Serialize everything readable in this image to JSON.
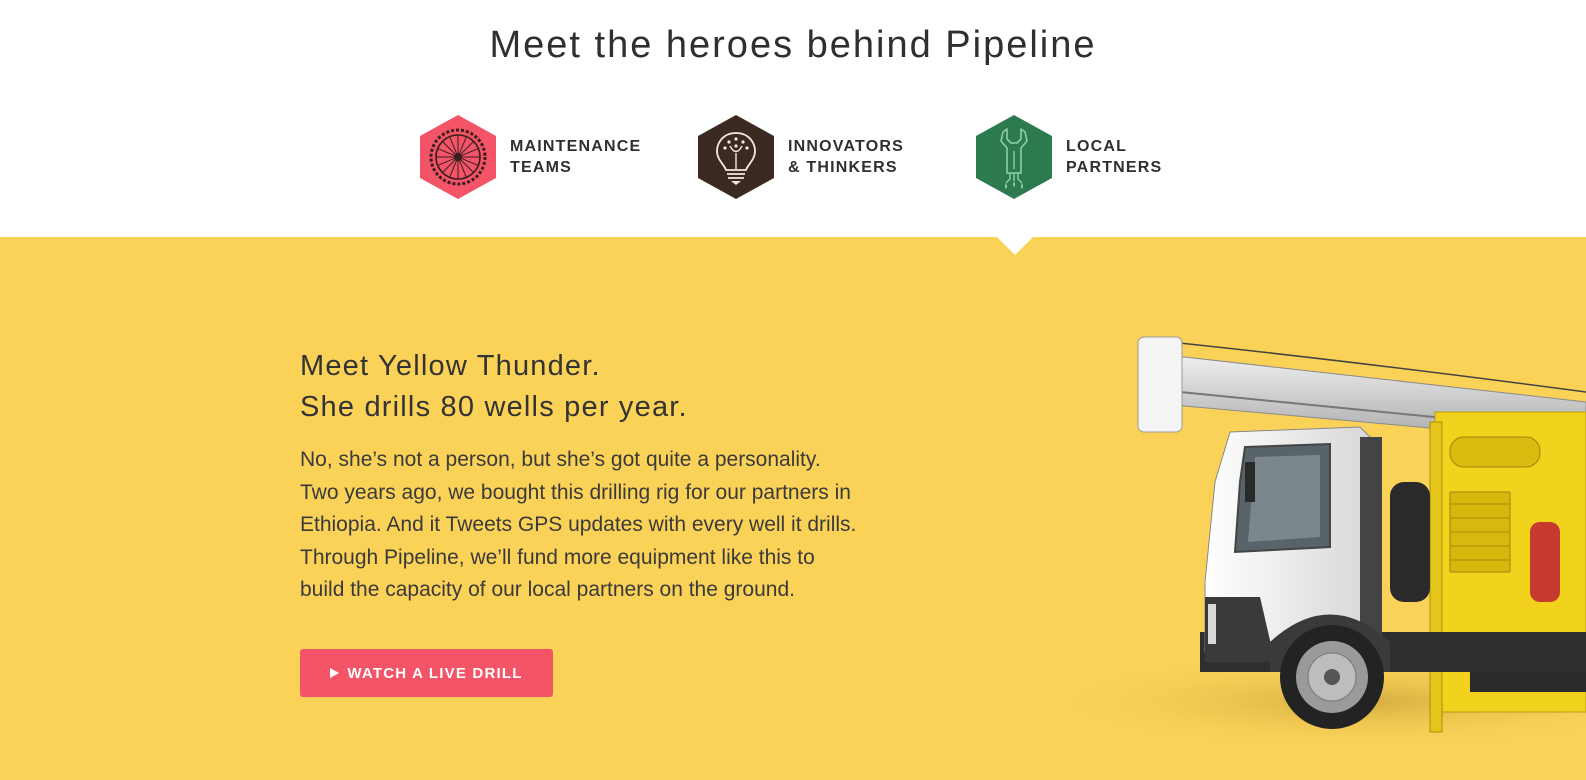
{
  "header": {
    "title": "Meet the heroes behind Pipeline"
  },
  "tabs": [
    {
      "line1": "MAINTENANCE",
      "line2": "TEAMS",
      "icon": "bicycle-wheel-icon",
      "color": "#f35467"
    },
    {
      "line1": "INNOVATORS",
      "line2": "& THINKERS",
      "icon": "lightbulb-icon",
      "color": "#3b2a22"
    },
    {
      "line1": "LOCAL",
      "line2": "PARTNERS",
      "icon": "wrench-icon",
      "color": "#2e7a4f"
    }
  ],
  "feature": {
    "title_line1": "Meet Yellow Thunder.",
    "title_line2": "She drills 80 wells per year.",
    "body_lines": [
      "No, she’s not a person, but she’s got quite a personality.",
      "Two years ago, we bought this drilling rig for our partners in",
      "Ethiopia. And it Tweets GPS updates with every well it drills.",
      "Through Pipeline, we’ll fund more equipment like this to",
      "build the capacity of our local partners on the ground."
    ],
    "cta_label": "WATCH A LIVE DRILL",
    "background_color": "#fbd258"
  }
}
